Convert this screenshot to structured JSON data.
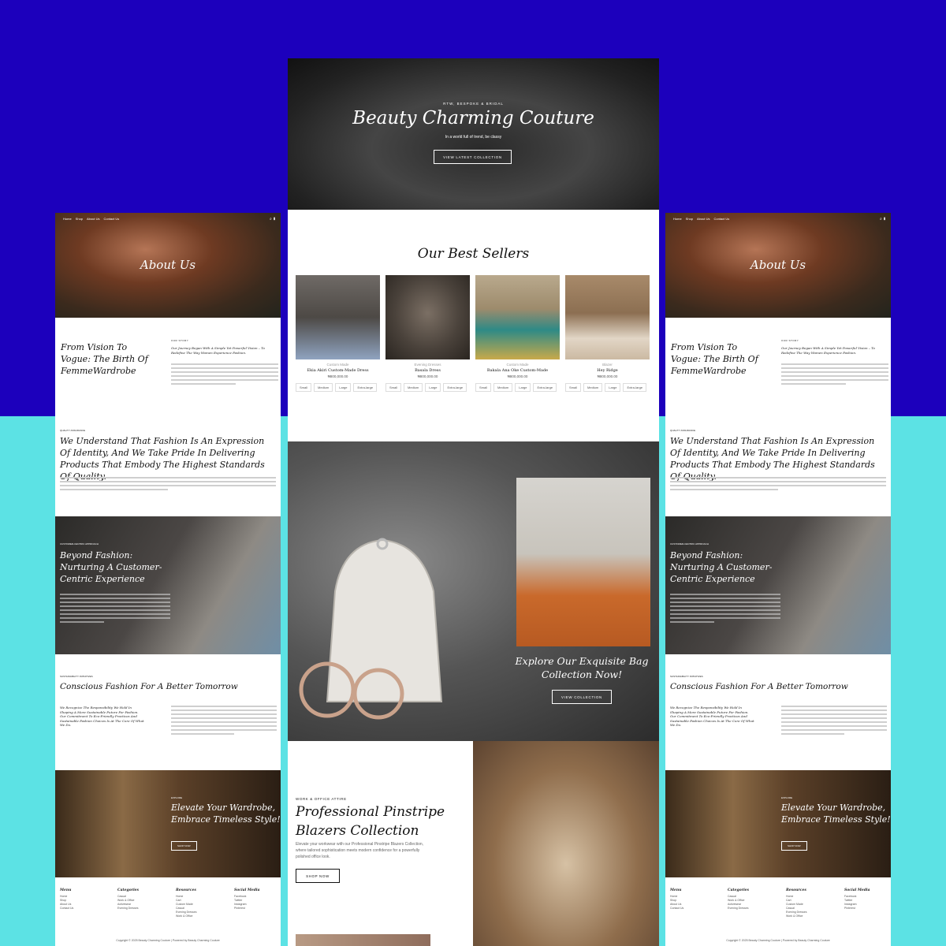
{
  "about_page": {
    "nav": [
      "Home",
      "Shop",
      "About Us",
      "Contact Us"
    ],
    "icons": [
      "search-icon",
      "bag-icon"
    ],
    "hero_title": "About Us",
    "story_heading": "From Vision To Vogue: The Birth Of FemmeWardrobe",
    "story_label": "OUR STORY",
    "story_subtitle": "Our Journey Began With A Simple Yet Powerful Vision – To Redefine The Way Women Experience Fashion.",
    "quality_label": "QUALITY ASSURANCE",
    "quality_heading": "We Understand That Fashion Is An Expression Of Identity, And We Take Pride In Delivering Products That Embody The Highest Standards Of Quality.",
    "customer_label": "CUSTOMER-CENTRIC APPROACH",
    "customer_heading": "Beyond Fashion: Nurturing A Customer-Centric Experience",
    "sustain_label": "SUSTAINABILITY INITIATIVES",
    "sustain_heading": "Conscious Fashion For A Better Tomorrow",
    "sustain_quote": "We Recognize The Responsibility We Hold In Shaping A More Sustainable Future For Fashion. Our Commitment To Eco-Friendly Practices And Sustainable Fashion Choices Is At The Core Of What We Do.",
    "elevate_label": "EXPLORE",
    "elevate_heading": "Elevate Your Wardrobe, Embrace Timeless Style!",
    "elevate_button": "SHOP NOW",
    "footer": {
      "menu_title": "Menu",
      "menu": [
        "Home",
        "Shop",
        "About Us",
        "Contact Us"
      ],
      "categories_title": "Categories",
      "categories": [
        "Casual",
        "Work & Office",
        "Activewear",
        "Evening Dresses"
      ],
      "resources_title": "Resources",
      "resources": [
        "Home",
        "Cart",
        "Custom Made",
        "Casual",
        "Evening Dresses",
        "Work & Office"
      ],
      "social_title": "Social Media",
      "social": [
        "Facebook",
        "Twitter",
        "Instagram",
        "Pinterest"
      ],
      "copyright": "Copyright © 2025 Beauty Charming Couture | Powered by Beauty Charming Couture"
    }
  },
  "home_page": {
    "hero": {
      "eyebrow": "RTW, BESPOKE & BRIDAL",
      "title": "Beauty Charming Couture",
      "tagline": "In a world full of trend, be classy",
      "button": "VIEW LATEST COLLECTION"
    },
    "best_sellers_title": "Our Best Sellers",
    "products": [
      {
        "category": "Custom Made",
        "name": "Ekia Akiri Custom-Made Dress",
        "price": "₦800,000.00",
        "sizes": [
          "Small",
          "Medium",
          "Large",
          "Extra-large"
        ]
      },
      {
        "category": "Evening Dresses",
        "name": "Basala Dress",
        "price": "₦800,000.00",
        "sizes": [
          "Small",
          "Medium",
          "Large",
          "Extra-large"
        ]
      },
      {
        "category": "Custom Made",
        "name": "Bakala Ana Oke Custom-Made",
        "price": "₦800,000.00",
        "sizes": [
          "Small",
          "Medium",
          "Large",
          "Extra-large"
        ]
      },
      {
        "category": "Blazer",
        "name": "Hey Ridge",
        "price": "₦800,000.00",
        "sizes": [
          "Small",
          "Medium",
          "Large",
          "Extra-large"
        ]
      }
    ],
    "bag": {
      "heading": "Explore Our Exquisite Bag Collection Now!",
      "button": "VIEW COLLECTION"
    },
    "blazer": {
      "label": "WORK & OFFICE ATTIRE",
      "heading": "Professional Pinstripe Blazers Collection",
      "text": "Elevate your workwear with our Professional Pinstripe Blazers Collection, where tailored sophistication meets modern confidence for a powerfully polished office look.",
      "button": "SHOP NOW"
    }
  },
  "colors": {
    "top_background": "#1c00bc",
    "bottom_background": "#5ce2e4"
  }
}
